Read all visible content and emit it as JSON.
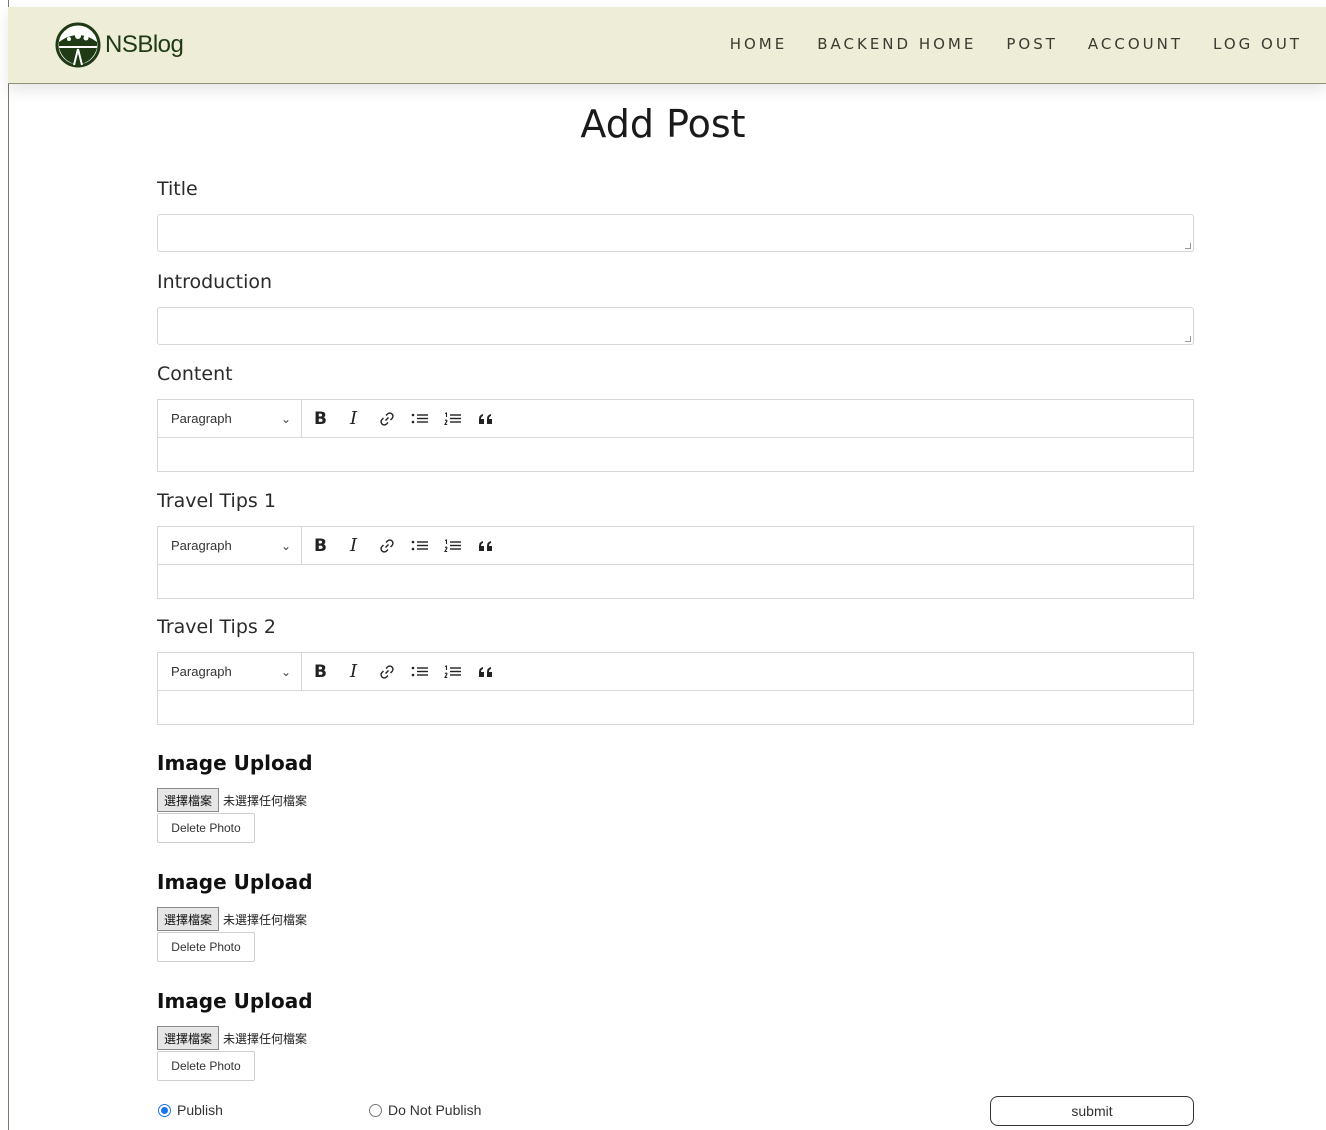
{
  "brand": {
    "name": "NSBlog",
    "logo_icon": "sun-field-logo-icon"
  },
  "nav": {
    "items": [
      {
        "label": "HOME"
      },
      {
        "label": "BACKEND HOME"
      },
      {
        "label": "POST"
      },
      {
        "label": "ACCOUNT"
      },
      {
        "label": "LOG OUT"
      }
    ]
  },
  "page": {
    "title": "Add Post"
  },
  "form": {
    "title_label": "Title",
    "title_value": "",
    "intro_label": "Introduction",
    "intro_value": "",
    "editors": [
      {
        "label": "Content",
        "heading_option": "Paragraph"
      },
      {
        "label": "Travel Tips 1",
        "heading_option": "Paragraph"
      },
      {
        "label": "Travel Tips 2",
        "heading_option": "Paragraph"
      }
    ],
    "uploads": [
      {
        "heading": "Image Upload",
        "choose_label": "選擇檔案",
        "status": "未選擇任何檔案",
        "delete_label": "Delete Photo"
      },
      {
        "heading": "Image Upload",
        "choose_label": "選擇檔案",
        "status": "未選擇任何檔案",
        "delete_label": "Delete Photo"
      },
      {
        "heading": "Image Upload",
        "choose_label": "選擇檔案",
        "status": "未選擇任何檔案",
        "delete_label": "Delete Photo"
      }
    ],
    "publish_options": [
      {
        "label": "Publish",
        "checked": true
      },
      {
        "label": "Do Not Publish",
        "checked": false
      }
    ],
    "submit_label": "submit"
  },
  "colors": {
    "navbar_bg": "#ededd8",
    "brand_text": "#1f3a14",
    "radio_accent": "#1a73e8"
  }
}
